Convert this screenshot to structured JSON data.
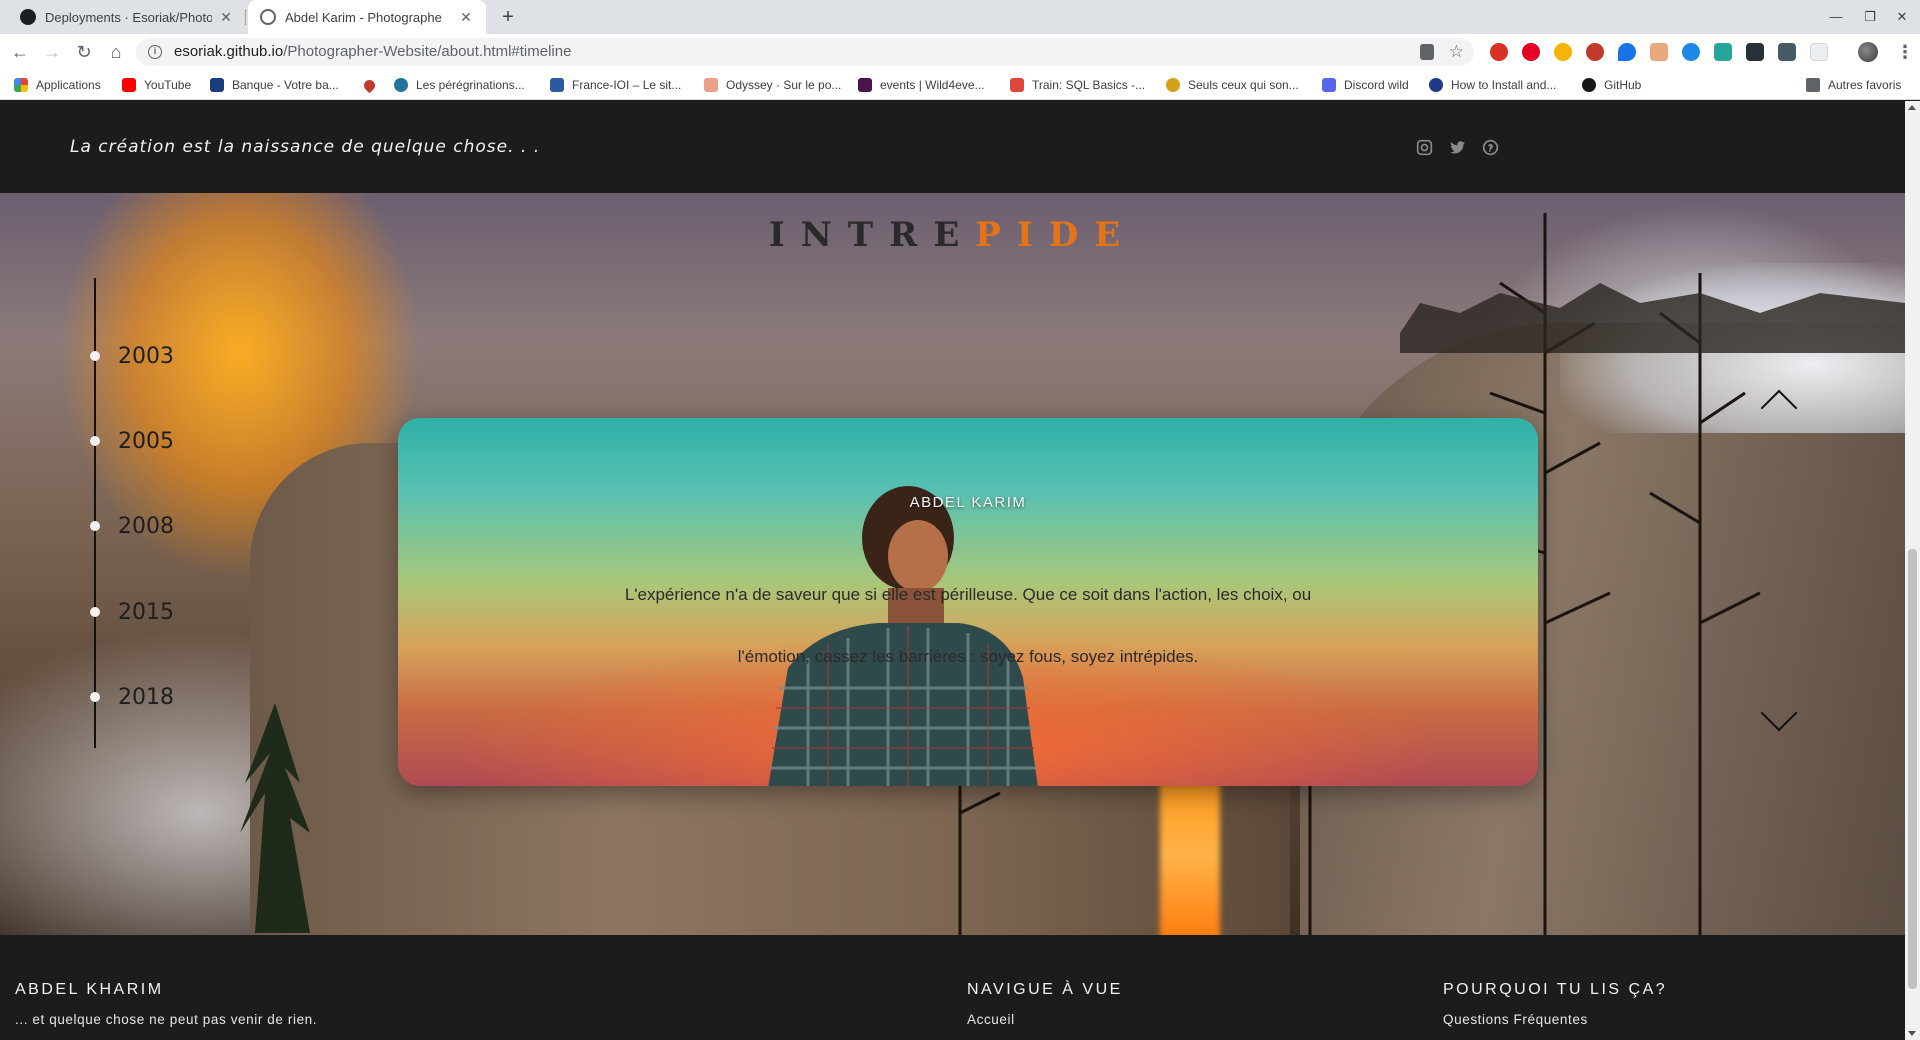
{
  "browser": {
    "tabs": [
      {
        "title": "Deployments · Esoriak/Photogr",
        "active": false
      },
      {
        "title": "Abdel Karim - Photographe",
        "active": true
      }
    ],
    "address": {
      "host": "esoriak.github.io",
      "path": "/Photographer-Website/about.html#timeline"
    },
    "bookmarks": [
      {
        "label": "Applications",
        "color": "#ea4335"
      },
      {
        "label": "YouTube",
        "color": "#ff0000"
      },
      {
        "label": "Banque - Votre ba...",
        "color": "#1a3d7c"
      },
      {
        "label": "",
        "color": "#c0392b"
      },
      {
        "label": "Les pérégrinations...",
        "color": "#21759b"
      },
      {
        "label": "France-IOI – Le sit...",
        "color": "#2c5aa0"
      },
      {
        "label": "Odyssey · Sur le po...",
        "color": "#e8a08a"
      },
      {
        "label": "events | Wild4eve...",
        "color": "#4a154b"
      },
      {
        "label": "Train: SQL Basics -...",
        "color": "#e0463c"
      },
      {
        "label": "Seuls ceux qui son...",
        "color": "#d4a017"
      },
      {
        "label": "Discord wild",
        "color": "#5865f2"
      },
      {
        "label": "How to Install and...",
        "color": "#1e3a8a"
      },
      {
        "label": "GitHub",
        "color": "#181717"
      },
      {
        "label": "Autres favoris",
        "color": "#5f6368"
      }
    ]
  },
  "header": {
    "tagline": "La création est la naissance de quelque chose. . ."
  },
  "hero": {
    "title_prefix": "INTRE",
    "title_highlight": "PIDE",
    "timeline": [
      "2003",
      "2005",
      "2008",
      "2015",
      "2018"
    ],
    "card": {
      "name": "ABDEL KARIM",
      "quote": "L'expérience n'a de saveur que si elle est périlleuse. Que ce soit dans l'action, les choix, ou l'émotion, cassez les barrières : soyez fous, soyez intrépides."
    }
  },
  "footer": {
    "col1": {
      "title": "ABDEL KHARIM",
      "text": "... et quelque chose ne peut pas venir de rien."
    },
    "col2": {
      "title": "NAVIGUE À VUE",
      "text": "Accueil"
    },
    "col3": {
      "title": "POURQUOI TU LIS ÇA?",
      "text": "Questions Fréquentes"
    }
  },
  "colors": {
    "accent": "#e67316",
    "dark": "#1c1c1c"
  }
}
